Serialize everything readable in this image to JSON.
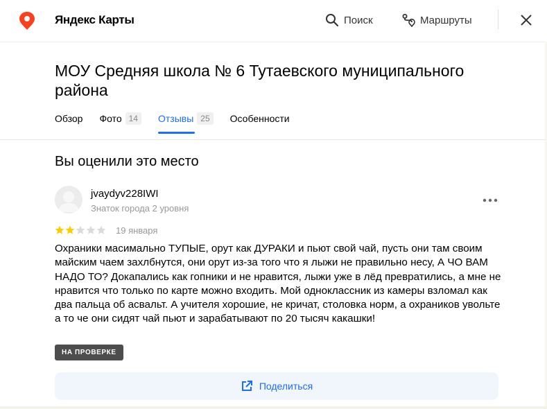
{
  "header": {
    "brand": "Яндекс Карты",
    "search_label": "Поиск",
    "routes_label": "Маршруты",
    "icons": {
      "logo": "map-pin-icon",
      "search": "search-icon",
      "routes": "route-icon",
      "close": "close-icon"
    },
    "brand_color": "#fc3f1d"
  },
  "place": {
    "title": "МОУ Средняя школа № 6 Тутаевского муниципального района"
  },
  "tabs": [
    {
      "label": "Обзор",
      "count": null,
      "active": false
    },
    {
      "label": "Фото",
      "count": "14",
      "active": false
    },
    {
      "label": "Отзывы",
      "count": "25",
      "active": true
    },
    {
      "label": "Особенности",
      "count": null,
      "active": false
    }
  ],
  "review_section": {
    "title": "Вы оценили это место",
    "review": {
      "author": "jvaydyv228IWI",
      "level": "Знаток города 2 уровня",
      "rating": 2,
      "max_rating": 5,
      "date": "19 января",
      "text": "Охраники масимально ТУПЫЕ, орут как ДУРАКИ и пьют свой чай, пусть они там своим майским чаем захлбнутся, они орут из-за того что я лыжи не правильно несу, А ЧО ВАМ НАДО ТО? Докапались как гопники и не нравится, лыжи уже в лёд превратились, а мне не нравится что только по карте можно входить. Мой одноклассник из камеры взломал как два пальца об асвальт. А учителя хорошие, не кричат, столовка норм, а охраников увольте а то че они сидят чай пьют и зарабатывают по 20 тысяч какашки!",
      "status_badge": "НА ПРОВЕРКЕ",
      "share_label": "Поделиться"
    }
  },
  "colors": {
    "accent": "#196dff",
    "star_filled": "#fc0",
    "star_empty": "#dadada",
    "badge_bg": "#4d4d4d",
    "share_bg": "#f1f5fc"
  }
}
